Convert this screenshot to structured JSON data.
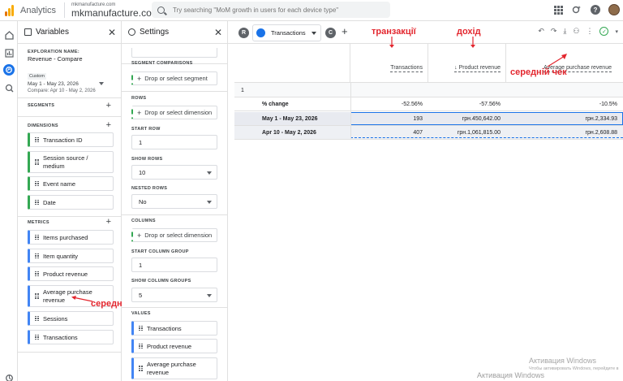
{
  "header": {
    "app_name": "Analytics",
    "account_small": "mkmanufacture.com",
    "account_big": "mkmanufacture.com",
    "search_placeholder": "Try searching \"MoM growth in users for each device type\""
  },
  "variables": {
    "title": "Variables",
    "exploration_label": "EXPLORATION NAME:",
    "exploration_name": "Revenue - Compare",
    "date_custom": "Custom",
    "date_range": "May 1 - May 23, 2026",
    "date_compare": "Compare: Apr 10 - May 2, 2026",
    "segments_label": "SEGMENTS",
    "dimensions_label": "DIMENSIONS",
    "dimensions": [
      "Transaction ID",
      "Session source / medium",
      "Event name",
      "Date"
    ],
    "metrics_label": "METRICS",
    "metrics": [
      "Items purchased",
      "Item quantity",
      "Product revenue",
      "Average purchase revenue",
      "Sessions",
      "Transactions"
    ]
  },
  "settings": {
    "title": "Settings",
    "segment_comparisons_label": "SEGMENT COMPARISONS",
    "drop_segment": "Drop or select segment",
    "rows_label": "ROWS",
    "drop_dimension": "Drop or select dimension",
    "start_row_label": "START ROW",
    "start_row": "1",
    "show_rows_label": "SHOW ROWS",
    "show_rows": "10",
    "nested_rows_label": "NESTED ROWS",
    "nested_rows": "No",
    "columns_label": "COLUMNS",
    "start_column_group_label": "START COLUMN GROUP",
    "start_column_group": "1",
    "show_column_groups_label": "SHOW COLUMN GROUPS",
    "show_column_groups": "5",
    "values_label": "VALUES",
    "values": [
      "Transactions",
      "Product revenue",
      "Average purchase revenue"
    ]
  },
  "main": {
    "tab_r": "R",
    "tab_label": "Transactions",
    "tab_c": "C",
    "columns": [
      "Transactions",
      "Product revenue",
      "Average purchase revenue"
    ],
    "group_number": "1",
    "rows": [
      {
        "label": "% change",
        "values": [
          "-52.56%",
          "-57.56%",
          "-10.5%"
        ]
      },
      {
        "label": "May 1 - May 23, 2026",
        "values": [
          "193",
          "грн.450,642.00",
          "грн.2,334.93"
        ]
      },
      {
        "label": "Apr 10 - May 2, 2026",
        "values": [
          "407",
          "грн.1,061,815.00",
          "грн.2,608.88"
        ]
      }
    ]
  },
  "annotations": {
    "transactions": "транзакції",
    "revenue": "дохід",
    "avg_check_top": "середній чек",
    "avg_check_left": "середній чек"
  },
  "watermark": {
    "line1": "Активация Windows",
    "line2": "Чтобы активировать Windows, перейдите в раздел «Параметры».",
    "line3": "Активация Windows"
  },
  "colors": {
    "accent": "#1a73e8",
    "dimension": "#34a853",
    "metric": "#4285f4",
    "annotation": "#e3262e"
  }
}
